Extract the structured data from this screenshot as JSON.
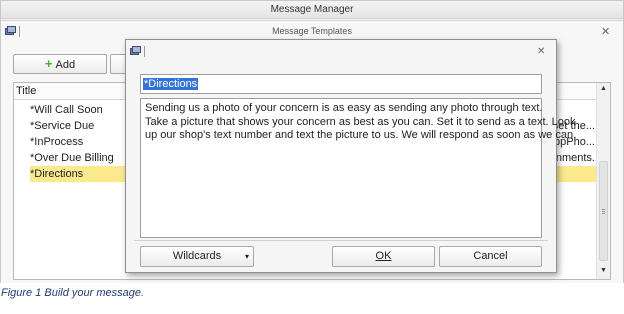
{
  "manager_window": {
    "title": "Message Manager"
  },
  "templates_window": {
    "title": "Message Templates",
    "add_label": "Add",
    "column_title": "Title",
    "rows": [
      {
        "title": "*Will Call Soon",
        "tail": ""
      },
      {
        "title": "*Service Due",
        "tail": "Set the..."
      },
      {
        "title": "*InProcess",
        "tail": "ppPho..."
      },
      {
        "title": "*Over Due Billing",
        "tail": "nments."
      },
      {
        "title": "*Directions",
        "tail": ""
      }
    ],
    "selected_row": 4
  },
  "edit_dialog": {
    "template_name": "*Directions",
    "body_lines": [
      "Sending us a photo of your concern is as easy as sending any photo through text.",
      "Take a picture that shows your concern as best as you can.  Set it to send as a text.  Look",
      "up our shop's text number and text the picture to us.  We will respond as soon as we can."
    ],
    "wildcards_label": "Wildcards",
    "ok_label": "OK",
    "cancel_label": "Cancel"
  },
  "caption": "Figure 1 Build your message.",
  "colors": {
    "selection_row": "#fbe98e",
    "text_selection": "#3375d6",
    "add_icon": "#4caf2a",
    "caption": "#1f3c74"
  },
  "icons": [
    "window-icon",
    "close-icon",
    "add-icon",
    "dropdown-caret-icon",
    "scroll-up-icon",
    "scroll-down-icon"
  ]
}
